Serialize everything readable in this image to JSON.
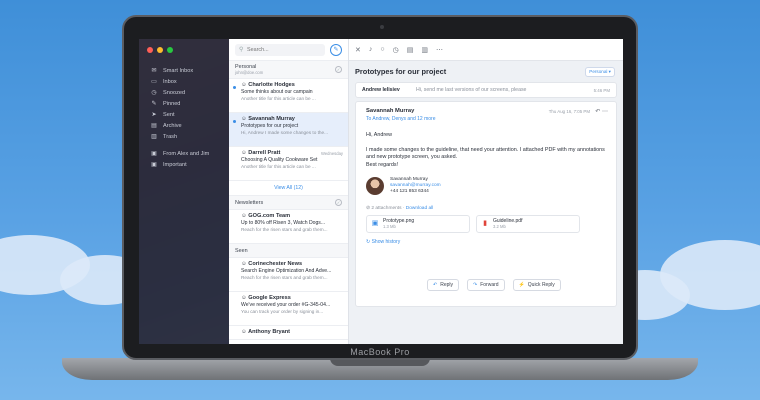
{
  "device": {
    "brand": "MacBook Pro"
  },
  "sidebar": {
    "items": [
      {
        "label": "Smart Inbox",
        "icon": "smart-inbox-icon",
        "glyph": "✉"
      },
      {
        "label": "Inbox",
        "icon": "inbox-icon",
        "glyph": "▭"
      },
      {
        "label": "Snoozed",
        "icon": "snooze-icon",
        "glyph": "◷"
      },
      {
        "label": "Pinned",
        "icon": "pin-icon",
        "glyph": "✎"
      },
      {
        "label": "Sent",
        "icon": "sent-icon",
        "glyph": "➤"
      },
      {
        "label": "Archive",
        "icon": "archive-icon",
        "glyph": "▤"
      },
      {
        "label": "Trash",
        "icon": "trash-icon",
        "glyph": "▥"
      }
    ],
    "folders": [
      {
        "label": "From Alex and Jim",
        "icon": "folder-icon",
        "glyph": "▣"
      },
      {
        "label": "Important",
        "icon": "folder-icon",
        "glyph": "▣"
      }
    ],
    "traffic_colors": [
      "#ff5f57",
      "#febc2e",
      "#28c840"
    ]
  },
  "list": {
    "search_placeholder": "Search...",
    "groups": {
      "personal": {
        "title": "Personal",
        "subtitle": "john@doe.com",
        "messages": [
          {
            "from": "Charlotte Hodges",
            "date": "",
            "subject": "Some thinks about our campain",
            "preview": "Another title for this article can be ...",
            "unread": true
          },
          {
            "from": "Savannah Murray",
            "date": "",
            "subject": "Prototypes for our project",
            "preview": "Hi, Andrew I made some changes to the...",
            "unread": true
          },
          {
            "from": "Darrell Pratt",
            "date": "Wednesday",
            "subject": "Choosing A Quality Cookware Set",
            "preview": "Another title for this article can be ...",
            "unread": false
          }
        ],
        "view_all": "View All (12)"
      },
      "newsletters": {
        "title": "Newsletters",
        "messages": [
          {
            "from": "GOG.com Team",
            "date": "",
            "subject": "Up to 80% off Risen 3, Watch Dogs...",
            "preview": "Reach for the risen stars and grab them...",
            "unread": false
          }
        ]
      },
      "seen": {
        "title": "Seen",
        "messages": [
          {
            "from": "Corinechester News",
            "date": "",
            "subject": "Search Engine Optimization And Adve...",
            "preview": "Reach for the risen stars and grab them...",
            "unread": false
          },
          {
            "from": "Google Express",
            "date": "",
            "subject": "We've received your order #G-345-04...",
            "preview": "You can track your order by signing in...",
            "unread": false
          },
          {
            "from": "Anthony Bryant",
            "date": "",
            "subject": "",
            "preview": "",
            "unread": false
          }
        ]
      }
    }
  },
  "reader": {
    "thread_title": "Prototypes for our project",
    "folder_badge": "Personal",
    "collapsed": {
      "from": "Andrew Ielisiev",
      "preview": "Hi, send me last versions of our screens, please",
      "time": "5:46 PM"
    },
    "email": {
      "from": "Savannah Murray",
      "to": "To Andrew, Denys and 12 more",
      "time": "Thu Aug 16, 7:05 PM",
      "greeting": "Hi, Andrew",
      "body": "I made some changes to the guideline, that need your attention. I attached PDF with my annotations and new prototype screen, you asked.",
      "closing": "Best regards!",
      "signature": {
        "name": "Savannah Murray",
        "email": "savannah@murray.com",
        "phone": "+44 121 853 6344"
      },
      "attachments_label": "2 attachments",
      "download_all": "Download all",
      "attachments": [
        {
          "name": "Prototype.png",
          "size": "1.3 Mb",
          "icon": "image-file-icon",
          "color": "#3b8ee6",
          "glyph": "▣"
        },
        {
          "name": "Guideline.pdf",
          "size": "3.2 Mb",
          "icon": "pdf-file-icon",
          "color": "#e0443a",
          "glyph": "▮"
        }
      ],
      "show_history": "Show history"
    },
    "actions": [
      {
        "label": "Reply",
        "icon": "reply-icon",
        "glyph": "↶"
      },
      {
        "label": "Forward",
        "icon": "forward-icon",
        "glyph": "↷"
      },
      {
        "label": "Quick Reply",
        "icon": "quick-reply-icon",
        "glyph": "⚡"
      }
    ]
  }
}
